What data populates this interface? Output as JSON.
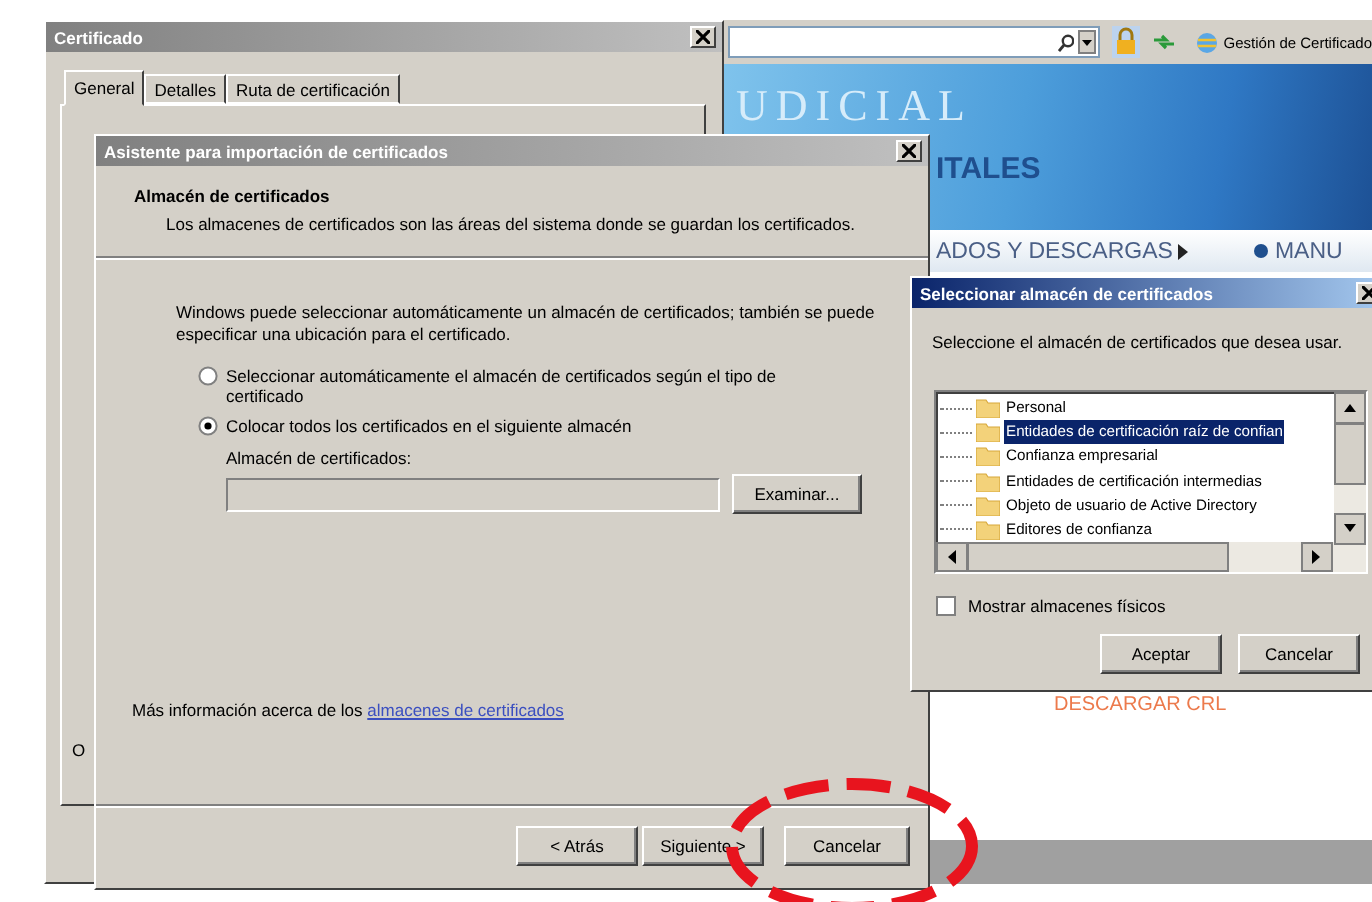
{
  "browser": {
    "tab_label": "Gestión de Certificado",
    "banner_title": "UDICIAL",
    "banner_subtitle": "ITALES",
    "menu": [
      {
        "label": "ADOS Y DESCARGAS",
        "kind": "submenu"
      },
      {
        "label": "MANU",
        "kind": "bullet"
      }
    ],
    "page_link": "DESCARGAR CRL"
  },
  "certificate_window": {
    "title": "Certificado",
    "tabs": [
      {
        "label": "General",
        "selected": true
      },
      {
        "label": "Detalles",
        "selected": false
      },
      {
        "label": "Ruta de certificación",
        "selected": false
      }
    ],
    "partial_text": "O"
  },
  "wizard": {
    "title": "Asistente para importación de certificados",
    "heading": "Almacén de certificados",
    "description": "Los almacenes de certificados son las áreas del sistema donde se guardan los certificados.",
    "body": "Windows puede seleccionar automáticamente un almacén de certificados; también se puede especificar una ubicación para el certificado.",
    "options": [
      {
        "label": "Seleccionar automáticamente el almacén de certificados según el tipo de certificado",
        "selected": false
      },
      {
        "label": "Colocar todos los certificados en el siguiente almacén",
        "selected": true
      }
    ],
    "store_label": "Almacén de certificados:",
    "browse_button": "Examinar...",
    "info_text": "Más información acerca de los ",
    "info_link": "almacenes de certificados",
    "buttons": [
      "< Atrás",
      "Siguiente >",
      "Cancelar"
    ]
  },
  "store_dialog": {
    "title": "Seleccionar almacén de certificados",
    "prompt": "Seleccione el almacén de certificados que desea usar.",
    "stores": [
      {
        "label": "Personal",
        "selected": false
      },
      {
        "label": "Entidades de certificación raíz de confian",
        "selected": true
      },
      {
        "label": "Confianza empresarial",
        "selected": false
      },
      {
        "label": "Entidades de certificación intermedias",
        "selected": false
      },
      {
        "label": "Objeto de usuario de Active Directory",
        "selected": false
      },
      {
        "label": "Editores de confianza",
        "selected": false
      }
    ],
    "show_physical": {
      "label": "Mostrar almacenes físicos",
      "checked": false
    },
    "buttons": [
      "Aceptar",
      "Cancelar"
    ]
  }
}
